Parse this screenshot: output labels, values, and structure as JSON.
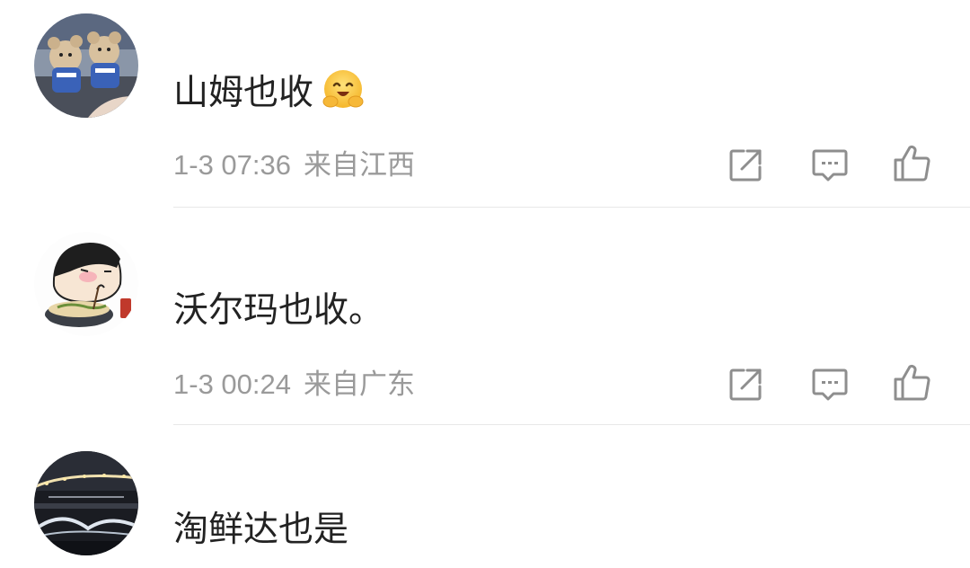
{
  "comments": [
    {
      "text": "山姆也收",
      "emoji": "smiling-hugging-face-emoji",
      "time": "1-3 07:36",
      "location": "来自江西"
    },
    {
      "text": "沃尔玛也收。",
      "time": "1-3 00:24",
      "location": "来自广东"
    },
    {
      "text": "淘鲜达也是"
    }
  ],
  "icons": {
    "share": "share-icon",
    "reply": "comment-icon",
    "like": "thumbs-up-icon"
  },
  "colors": {
    "text": "#222222",
    "meta": "#9a9a9a",
    "icon": "#8e8e8e",
    "divider": "#e8e8e8"
  }
}
